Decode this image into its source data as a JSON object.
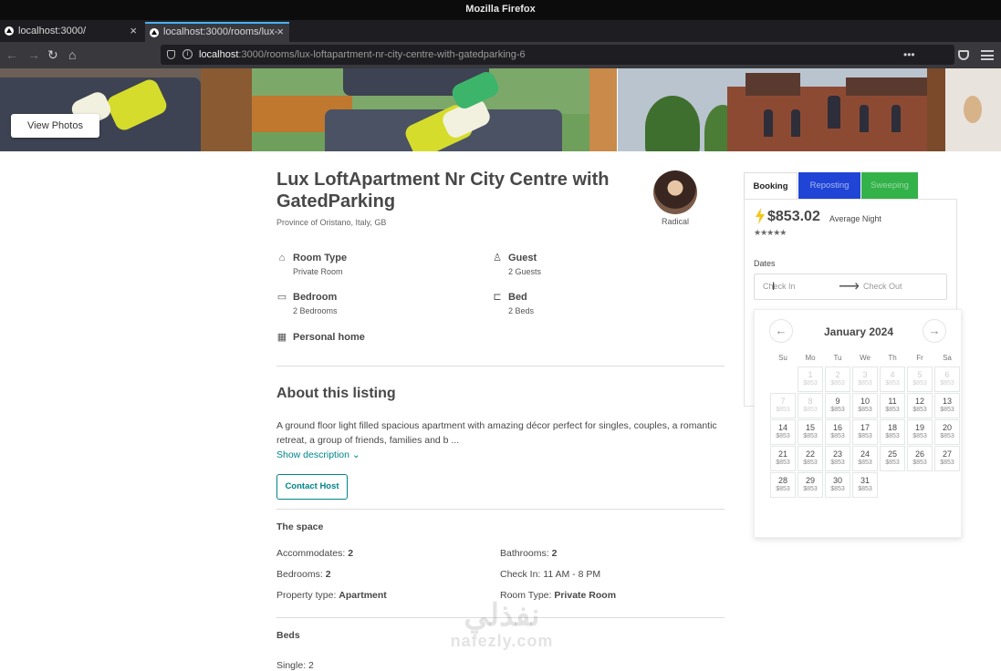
{
  "browser": {
    "window_title": "Mozilla Firefox",
    "tabs": [
      {
        "label": "localhost:3000/",
        "close": "×"
      },
      {
        "label": "localhost:3000/rooms/lux-",
        "close": "×"
      }
    ],
    "new_tab": "+",
    "url_host": "localhost",
    "url_rest": ":3000/rooms/lux-loftapartment-nr-city-centre-with-gatedparking-6",
    "nav": {
      "back": "←",
      "forward": "→",
      "reload": "↻",
      "home": "⌂"
    },
    "url_actions": "•••"
  },
  "hero": {
    "view_photos": "View Photos"
  },
  "listing": {
    "title": "Lux LoftApartment Nr City Centre with GatedParking",
    "location": "Province of Oristano, Italy, GB",
    "host_name": "Radical",
    "features": {
      "room_type": {
        "label": "Room Type",
        "value": "Private Room"
      },
      "guest": {
        "label": "Guest",
        "value": "2 Guests"
      },
      "bedroom": {
        "label": "Bedroom",
        "value": "2 Bedrooms"
      },
      "bed": {
        "label": "Bed",
        "value": "2 Beds"
      },
      "personal": {
        "label": "Personal home"
      }
    },
    "about_title": "About this listing",
    "about_text": "A ground floor light filled spacious apartment with amazing décor perfect for singles, couples, a romantic retreat, a group of friends, families and b ...",
    "show_description": "Show description ⌄",
    "contact_host": "Contact Host",
    "space_title": "The space",
    "space": {
      "accommodates": {
        "label": "Accommodates:",
        "value": "2"
      },
      "bathrooms": {
        "label": "Bathrooms:",
        "value": "2"
      },
      "bedrooms": {
        "label": "Bedrooms:",
        "value": "2"
      },
      "checkin": {
        "label": "Check In:",
        "value": "11 AM - 8 PM"
      },
      "property_type": {
        "label": "Property type:",
        "value": "Apartment"
      },
      "room_type": {
        "label": "Room Type:",
        "value": "Private Room"
      }
    },
    "beds_title": "Beds",
    "beds_cut": "Single: 2"
  },
  "booking": {
    "tabs": {
      "booking": "Booking",
      "reposting": "Reposting",
      "sweeping": "Sweeping"
    },
    "price": "$853.02",
    "per_night": "Average Night",
    "stars": "★★★★★",
    "dates_label": "Dates",
    "checkin_placeholder": "Check In",
    "checkout_placeholder": "Check Out",
    "calendar": {
      "month": "January 2024",
      "prev": "←",
      "next": "→",
      "weekdays": [
        "Su",
        "Mo",
        "Tu",
        "We",
        "Th",
        "Fr",
        "Sa"
      ],
      "first_weekday": 1,
      "days": [
        {
          "n": "1",
          "p": "$853",
          "blocked": true
        },
        {
          "n": "2",
          "p": "$853",
          "blocked": true
        },
        {
          "n": "3",
          "p": "$853",
          "blocked": true
        },
        {
          "n": "4",
          "p": "$853",
          "blocked": true
        },
        {
          "n": "5",
          "p": "$853",
          "blocked": true
        },
        {
          "n": "6",
          "p": "$853",
          "blocked": true
        },
        {
          "n": "7",
          "p": "$853",
          "blocked": true
        },
        {
          "n": "8",
          "p": "$853",
          "blocked": true
        },
        {
          "n": "9",
          "p": "$853",
          "blocked": false
        },
        {
          "n": "10",
          "p": "$853",
          "blocked": false
        },
        {
          "n": "11",
          "p": "$853",
          "blocked": false
        },
        {
          "n": "12",
          "p": "$853",
          "blocked": false
        },
        {
          "n": "13",
          "p": "$853",
          "blocked": false
        },
        {
          "n": "14",
          "p": "$853",
          "blocked": false
        },
        {
          "n": "15",
          "p": "$853",
          "blocked": false
        },
        {
          "n": "16",
          "p": "$853",
          "blocked": false
        },
        {
          "n": "17",
          "p": "$853",
          "blocked": false
        },
        {
          "n": "18",
          "p": "$853",
          "blocked": false
        },
        {
          "n": "19",
          "p": "$853",
          "blocked": false
        },
        {
          "n": "20",
          "p": "$853",
          "blocked": false
        },
        {
          "n": "21",
          "p": "$853",
          "blocked": false
        },
        {
          "n": "22",
          "p": "$853",
          "blocked": false
        },
        {
          "n": "23",
          "p": "$853",
          "blocked": false
        },
        {
          "n": "24",
          "p": "$853",
          "blocked": false
        },
        {
          "n": "25",
          "p": "$853",
          "blocked": false
        },
        {
          "n": "26",
          "p": "$853",
          "blocked": false
        },
        {
          "n": "27",
          "p": "$853",
          "blocked": false
        },
        {
          "n": "28",
          "p": "$853",
          "blocked": false
        },
        {
          "n": "29",
          "p": "$853",
          "blocked": false
        },
        {
          "n": "30",
          "p": "$853",
          "blocked": false
        },
        {
          "n": "31",
          "p": "$853",
          "blocked": false
        }
      ]
    }
  },
  "colors": {
    "accent": "#008489",
    "reposting": "#1f44d6",
    "sweeping": "#34b24a",
    "bolt": "#f5c518"
  },
  "watermark": {
    "arabic": "نفذلي",
    "latin": "nafezly.com"
  }
}
